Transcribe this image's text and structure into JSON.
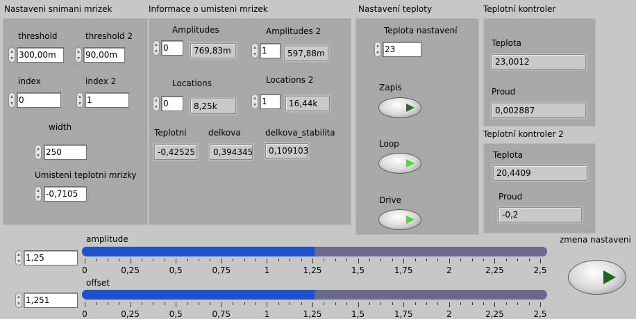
{
  "groups": {
    "snimani": {
      "title": "Nastaveni snimani mrizek",
      "threshold_label": "threshold",
      "threshold_value": "300,00m",
      "threshold2_label": "threshold 2",
      "threshold2_value": "90,00m",
      "index_label": "index",
      "index_value": "0",
      "index2_label": "index 2",
      "index2_value": "1",
      "width_label": "width",
      "width_value": "250",
      "umisteni_label": "Umisteni teplotni mrizky",
      "umisteni_value": "-0,7105"
    },
    "informace": {
      "title": "Informace o umisteni mrizek",
      "amplitudes_label": "Amplitudes",
      "amplitudes_index": "0",
      "amplitudes_value": "769,83m",
      "amplitudes2_label": "Amplitudes 2",
      "amplitudes2_index": "1",
      "amplitudes2_value": "597,88m",
      "locations_label": "Locations",
      "locations_index": "0",
      "locations_value": "8,25k",
      "locations2_label": "Locations 2",
      "locations2_index": "1",
      "locations2_value": "16,44k",
      "teplotni_label": "Teplotni",
      "teplotni_value": "-0,42525",
      "delkova_label": "delkova",
      "delkova_value": "0,394345",
      "delkova_stab_label": "delkova_stabilita",
      "delkova_stab_value": "0,109103"
    },
    "teploty": {
      "title": "Nastavení teploty",
      "teplota_nast_label": "Teplota nastavení",
      "teplota_nast_value": "23",
      "zapis_label": "Zapis",
      "loop_label": "Loop",
      "drive_label": "Drive"
    },
    "kontroler": {
      "title": "Teplotní kontroler",
      "teplota_label": "Teplota",
      "teplota_value": "23,0012",
      "proud_label": "Proud",
      "proud_value": "0,002887"
    },
    "kontroler2": {
      "title": "Teplotní kontroler 2",
      "teplota_label": "Teplota",
      "teplota_value": "20,4409",
      "proud_label": "Proud",
      "proud_value": "-0,2"
    }
  },
  "sliders": {
    "amplitude": {
      "label": "amplitude",
      "value_text": "1,25",
      "value": 1.25
    },
    "offset": {
      "label": "offset",
      "value_text": "1,251",
      "value": 1.251
    },
    "scale_min": 0,
    "scale_max": 2.5,
    "tick_labels": [
      "0",
      "0,25",
      "0,5",
      "0,75",
      "1",
      "1,25",
      "1,5",
      "1,75",
      "2",
      "2,25",
      "2,5"
    ]
  },
  "zmena": {
    "label": "zmena nastaveni"
  },
  "colors": {
    "slider_fill": "#1f52c8",
    "slider_track": "#6a6a8c",
    "led_on": "#43e034",
    "led_off": "#2c6b25"
  }
}
